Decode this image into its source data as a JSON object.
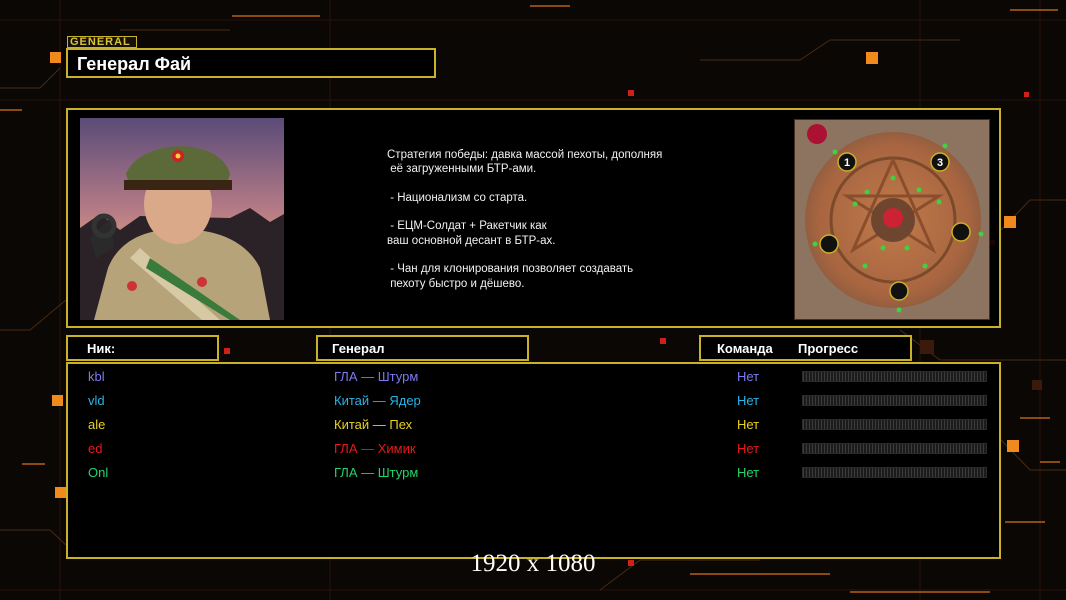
{
  "general_tag": "GENERAL",
  "general_name": "Генерал Фай",
  "description": "Стратегия победы: давка массой пехоты, дополняя\n её загруженными БТР-ами.\n\n - Национализм со старта.\n\n - ЕЦМ-Солдат + Ракетчик как\nваш основной десант в БТР-ах.\n\n - Чан для клонирования позволяет создавать\n пехоту быстро и дёшево.",
  "headers": {
    "nick": "Ник:",
    "general": "Генерал",
    "team": "Команда",
    "progress": "Прогресс"
  },
  "players": [
    {
      "nick": "kbl",
      "general": "ГЛА — Штурм",
      "team": "Нет",
      "color": "#7d79f2",
      "progress": 0
    },
    {
      "nick": "vld",
      "general": "Китай — Ядер",
      "team": "Нет",
      "color": "#27b4e8",
      "progress": 0
    },
    {
      "nick": "ale",
      "general": "Китай — Пех",
      "team": "Нет",
      "color": "#e8d11f",
      "progress": 0
    },
    {
      "nick": "ed",
      "general": "ГЛА — Химик",
      "team": "Нет",
      "color": "#e8191c",
      "progress": 0
    },
    {
      "nick": "Onl",
      "general": "ГЛА — Штурм",
      "team": "Нет",
      "color": "#22d46a",
      "progress": 0
    }
  ],
  "minimap": {
    "start_labels": [
      "1",
      "3"
    ]
  },
  "resolution_watermark": "1920 x 1080",
  "colors": {
    "frame": "#c9b227",
    "background": "#0b0705",
    "accent_orange": "#f08a1d"
  }
}
